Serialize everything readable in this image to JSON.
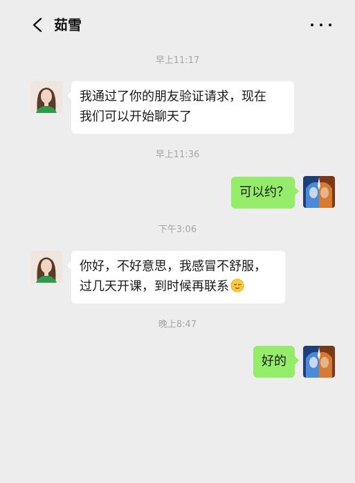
{
  "header": {
    "contact_name": "茹雪",
    "back_icon": "chevron-left-icon",
    "more_icon": "more-dots-icon"
  },
  "messages": [
    {
      "time": "早上11:17",
      "direction": "incoming",
      "lines": [
        "我通过了你的朋友验证请求，现在",
        "我们可以开始聊天了"
      ]
    },
    {
      "time": "早上11:36",
      "direction": "outgoing",
      "lines": [
        "可以约？"
      ]
    },
    {
      "time": "下午3:06",
      "direction": "incoming",
      "lines": [
        "你好，不好意思，我感冒不舒服，",
        "过几天开课，到时候再联系"
      ],
      "trailing_emoji": "relieved-face-emoji"
    },
    {
      "time": "晚上8:47",
      "direction": "outgoing",
      "lines": [
        "好的"
      ]
    }
  ],
  "colors": {
    "background": "#ededed",
    "incoming_bubble": "#ffffff",
    "outgoing_bubble": "#95ec69",
    "timestamp_text": "#a6a6a6"
  }
}
